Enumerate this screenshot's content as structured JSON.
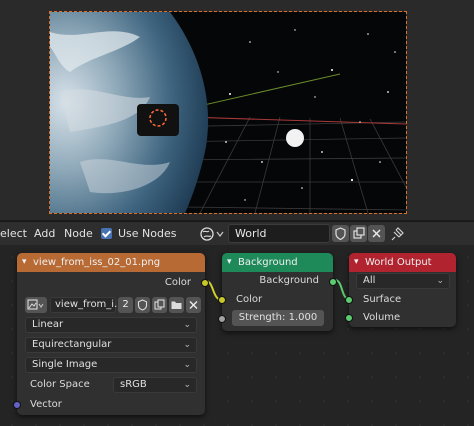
{
  "header": {
    "select_label": "elect",
    "add_label": "Add",
    "node_label": "Node",
    "use_nodes_label": "Use Nodes",
    "use_nodes_checked": true,
    "world_name": "World"
  },
  "image_node": {
    "title": "view_from_iss_02_01.png",
    "output_color_label": "Color",
    "image_name": "view_from_i...",
    "user_count": "2",
    "interpolation": "Linear",
    "projection": "Equirectangular",
    "source": "Single Image",
    "color_space_label": "Color Space",
    "color_space_value": "sRGB",
    "vector_label": "Vector",
    "header_color": "#b86a35"
  },
  "background_node": {
    "title": "Background",
    "output_label": "Background",
    "color_label": "Color",
    "strength_label": "Strength:",
    "strength_value": "1.000",
    "header_color": "#1e8a5a"
  },
  "output_node": {
    "title": "World Output",
    "target": "All",
    "surface_label": "Surface",
    "volume_label": "Volume",
    "header_color": "#b0232f"
  }
}
